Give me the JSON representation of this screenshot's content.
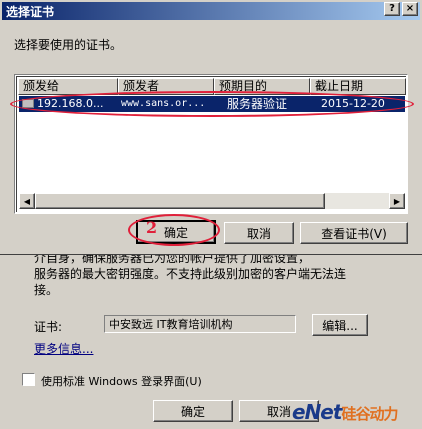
{
  "dialog": {
    "title": "选择证书",
    "help_btn": "?",
    "close_btn": "×",
    "prompt": "选择要使用的证书。",
    "columns": [
      "颁发给",
      "颁发者",
      "预期目的",
      "截止日期"
    ],
    "rows": [
      {
        "issued_to": "192.168.0...",
        "issuer": "www.sans.or...",
        "purpose": "服务器验证",
        "expires": "2015-12-20"
      }
    ],
    "ok_label": "确定",
    "cancel_label": "取消",
    "view_cert_label": "查看证书(V)"
  },
  "background_dialog": {
    "text_line1": "介自身，确保服务器已为您的帐户提供了加密设置，",
    "text_line2": "服务器的最大密钥强度。不支持此级别加密的客户端无法连",
    "text_line3": "接。",
    "cert_label": "证书:",
    "cert_value": "中安致远  IT教育培训机构",
    "edit_label": "编辑...",
    "more_info": "更多信息...",
    "checkbox_label": "使用标准 Windows 登录界面(U)",
    "ok_label": "确定",
    "cancel_label": "取消"
  },
  "annotations": {
    "step_number": "2"
  },
  "watermark": {
    "brand": "eNet",
    "cn": "硅谷动力"
  },
  "colors": {
    "selection": "#0a246a",
    "annotation": "#e0203a",
    "face": "#d4d0c8"
  }
}
